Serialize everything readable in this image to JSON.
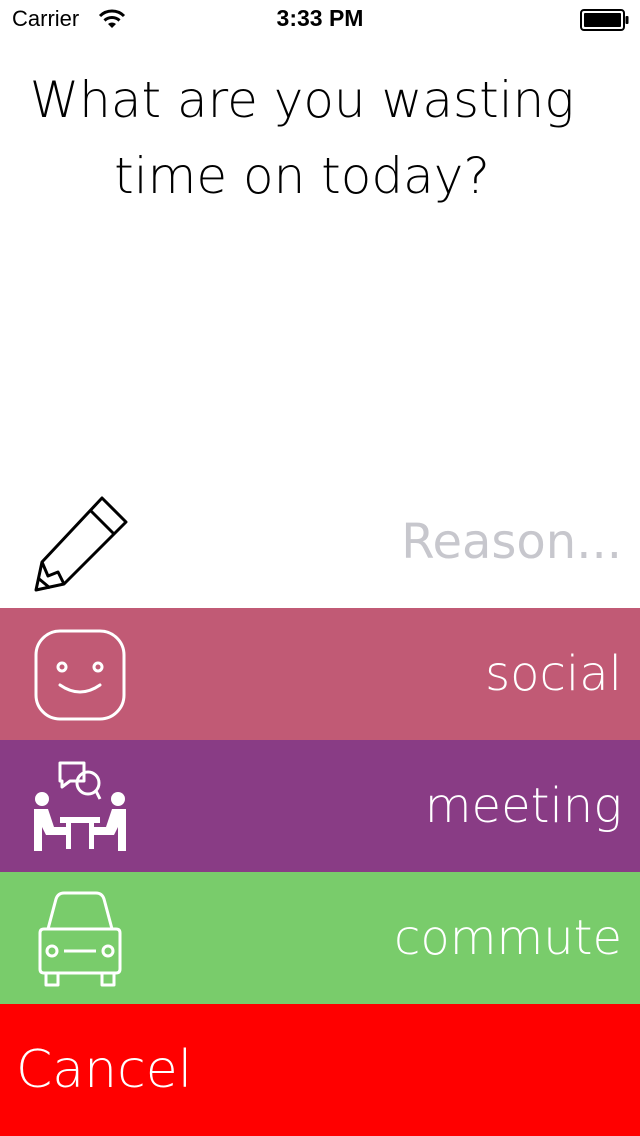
{
  "status_bar": {
    "carrier": "Carrier",
    "time": "3:33 PM",
    "wifi_icon": "wifi-icon",
    "battery_icon": "battery-icon"
  },
  "prompt": {
    "line1": "What are you wasting",
    "line2": "time on today?"
  },
  "reason": {
    "icon": "pencil-icon",
    "value": "",
    "placeholder": "Reason..."
  },
  "categories": [
    {
      "label": "social",
      "icon": "smiley-icon",
      "color": "#c15a75"
    },
    {
      "label": "meeting",
      "icon": "meeting-icon",
      "color": "#893c85"
    },
    {
      "label": "commute",
      "icon": "car-icon",
      "color": "#79cc6b"
    }
  ],
  "cancel": {
    "label": "Cancel",
    "color": "#ff0000"
  }
}
